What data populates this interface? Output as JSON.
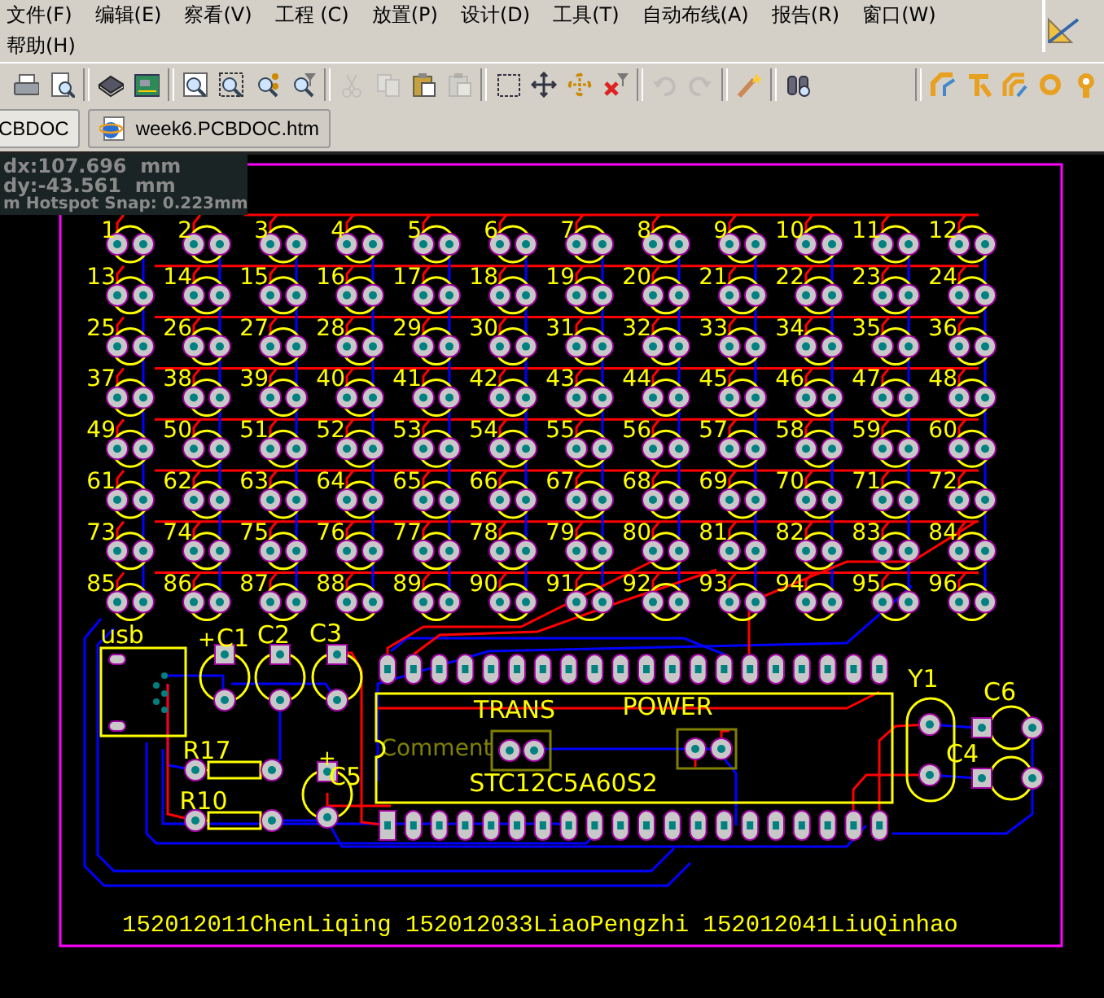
{
  "menu": {
    "items": [
      "文件(F)",
      "编辑(E)",
      "察看(V)",
      "工程 (C)",
      "放置(P)",
      "设计(D)",
      "工具(T)",
      "自动布线(A)",
      "报告(R)",
      "窗口(W)",
      "帮助(H)"
    ]
  },
  "toolbar": {
    "groups": [
      {
        "buttons": [
          {
            "kind": "print",
            "disabled": false
          },
          {
            "kind": "preview",
            "disabled": false
          }
        ]
      },
      {
        "buttons": [
          {
            "kind": "chip",
            "disabled": false
          },
          {
            "kind": "board",
            "disabled": false
          }
        ]
      },
      {
        "buttons": [
          {
            "kind": "zoom",
            "disabled": false
          },
          {
            "kind": "zoom-area",
            "disabled": false
          },
          {
            "kind": "zoom-selected",
            "disabled": false
          },
          {
            "kind": "zoom-filter",
            "disabled": false
          }
        ]
      },
      {
        "buttons": [
          {
            "kind": "cut",
            "disabled": true
          },
          {
            "kind": "copy",
            "disabled": true
          },
          {
            "kind": "paste",
            "disabled": false
          },
          {
            "kind": "paste-array",
            "disabled": true
          }
        ]
      },
      {
        "buttons": [
          {
            "kind": "select-area",
            "disabled": false
          },
          {
            "kind": "move",
            "disabled": false
          },
          {
            "kind": "select-cross",
            "disabled": false
          },
          {
            "kind": "clear-filter",
            "disabled": false
          }
        ]
      },
      {
        "buttons": [
          {
            "kind": "undo",
            "disabled": true
          },
          {
            "kind": "redo",
            "disabled": true
          }
        ]
      },
      {
        "buttons": [
          {
            "kind": "wand",
            "disabled": false
          }
        ]
      },
      {
        "buttons": [
          {
            "kind": "inspect",
            "disabled": false
          }
        ]
      },
      {
        "buttons": [
          {
            "kind": "route",
            "disabled": false
          },
          {
            "kind": "route-diff",
            "disabled": false
          },
          {
            "kind": "route-multi",
            "disabled": false
          },
          {
            "kind": "via",
            "disabled": false
          },
          {
            "kind": "pad",
            "disabled": false
          }
        ]
      }
    ]
  },
  "tabs": [
    {
      "label": "CBDOC",
      "selected": true
    },
    {
      "label": "week6.PCBDOC.htm",
      "selected": false
    }
  ],
  "readout": {
    "dx": "dx:107.696  mm",
    "dy": "dy:-43.561  mm",
    "snap": "m Hotspot Snap: 0.223mm"
  },
  "pcb": {
    "led_labels": [
      "1",
      "2",
      "3",
      "4",
      "5",
      "6",
      "7",
      "8",
      "9",
      "10",
      "11",
      "12",
      "13",
      "14",
      "15",
      "16",
      "17",
      "18",
      "19",
      "20",
      "21",
      "22",
      "23",
      "24",
      "25",
      "26",
      "27",
      "28",
      "29",
      "30",
      "31",
      "32",
      "33",
      "34",
      "35",
      "36",
      "37",
      "38",
      "39",
      "40",
      "41",
      "42",
      "43",
      "44",
      "45",
      "46",
      "47",
      "48",
      "49",
      "50",
      "51",
      "52",
      "53",
      "54",
      "55",
      "56",
      "57",
      "58",
      "59",
      "60",
      "61",
      "62",
      "63",
      "64",
      "65",
      "66",
      "67",
      "68",
      "69",
      "70",
      "71",
      "72",
      "73",
      "74",
      "75",
      "76",
      "77",
      "78",
      "79",
      "80",
      "81",
      "82",
      "83",
      "84",
      "85",
      "86",
      "87",
      "88",
      "89",
      "90",
      "91",
      "92",
      "93",
      "94",
      "95",
      "96"
    ],
    "components": [
      {
        "kind": "usb",
        "label": "usb"
      },
      {
        "kind": "capacitor_polar",
        "label": "C1",
        "polarity": "+"
      },
      {
        "kind": "capacitor",
        "label": "C2"
      },
      {
        "kind": "capacitor",
        "label": "C3"
      },
      {
        "kind": "resistor",
        "label": "R17"
      },
      {
        "kind": "resistor",
        "label": "R10"
      },
      {
        "kind": "capacitor_polar",
        "label": "C5",
        "polarity": "+"
      },
      {
        "kind": "jumper",
        "label": "TRANS",
        "comment": "Comment"
      },
      {
        "kind": "jumper",
        "label": "POWER"
      },
      {
        "kind": "ic",
        "label": "STC12C5A60S2"
      },
      {
        "kind": "crystal",
        "label": "Y1"
      },
      {
        "kind": "capacitor_small",
        "label": "C6"
      },
      {
        "kind": "capacitor_small",
        "label": "C4"
      }
    ],
    "credit": "152012011ChenLiqing 152012033LiaoPengzhi 152012041LiuQinhao"
  }
}
